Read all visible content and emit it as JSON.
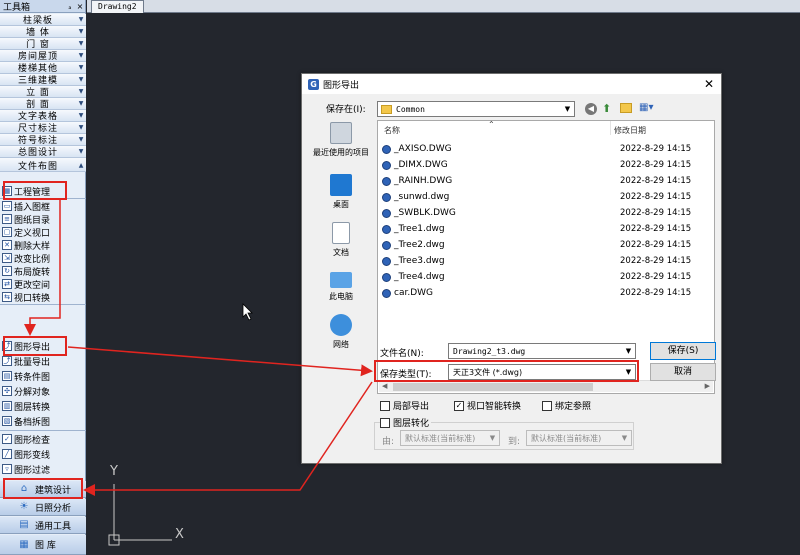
{
  "toolbox": {
    "title": "工具箱",
    "pin": "ₐ",
    "close": "×",
    "categories": [
      "柱梁板",
      "墙 体",
      "门 窗",
      "房间屋顶",
      "楼梯其他",
      "三维建模",
      "立 面",
      "剖 面",
      "文字表格",
      "尺寸标注",
      "符号标注",
      "总图设计",
      "文件布图"
    ],
    "commands": [
      "工程管理",
      "插入图框",
      "图纸目录",
      "定义视口",
      "删除大样",
      "改变比例",
      "布局旋转",
      "更改空间",
      "视口转换",
      "图形导出",
      "批量导出",
      "转条件图",
      "分解对象",
      "图层转换",
      "备档拆图",
      "图形检查",
      "图形变线",
      "图形过滤"
    ],
    "sections": [
      "建筑设计",
      "日照分析",
      "通用工具",
      "图 库"
    ]
  },
  "document": {
    "tab": "Drawing2"
  },
  "axis": {
    "y": "Y",
    "x": "X"
  },
  "dialog": {
    "title": "图形导出",
    "save_in_label": "保存在(I):",
    "save_in_value": "Common",
    "places": [
      "最近使用的项目",
      "桌面",
      "文档",
      "此电脑",
      "网络"
    ],
    "columns": {
      "name": "名称",
      "date": "修改日期"
    },
    "files": [
      {
        "name": "_AXISO.DWG",
        "date": "2022-8-29 14:15"
      },
      {
        "name": "_DIMX.DWG",
        "date": "2022-8-29 14:15"
      },
      {
        "name": "_RAINH.DWG",
        "date": "2022-8-29 14:15"
      },
      {
        "name": "_sunwd.dwg",
        "date": "2022-8-29 14:15"
      },
      {
        "name": "_SWBLK.DWG",
        "date": "2022-8-29 14:15"
      },
      {
        "name": "_Tree1.dwg",
        "date": "2022-8-29 14:15"
      },
      {
        "name": "_Tree2.dwg",
        "date": "2022-8-29 14:15"
      },
      {
        "name": "_Tree3.dwg",
        "date": "2022-8-29 14:15"
      },
      {
        "name": "_Tree4.dwg",
        "date": "2022-8-29 14:15"
      },
      {
        "name": "car.DWG",
        "date": "2022-8-29 14:15"
      }
    ],
    "filename_label": "文件名(N):",
    "filename_value": "Drawing2_t3.dwg",
    "filetype_label": "保存类型(T):",
    "filetype_value": "天正3文件 (*.dwg)",
    "save_button": "保存(S)",
    "cancel_button": "取消",
    "opt_partial": "局部导出",
    "opt_viewport": "视口智能转换",
    "opt_bind": "绑定参照",
    "opt_layer": "图层转化",
    "from_label": "由:",
    "from_value": "默认标准(当前标准)",
    "to_label": "到:",
    "to_value": "默认标准(当前标准)"
  },
  "colors": {
    "canvas": "#23262d",
    "highlight": "#e0241f",
    "accent": "#2f63b7"
  }
}
